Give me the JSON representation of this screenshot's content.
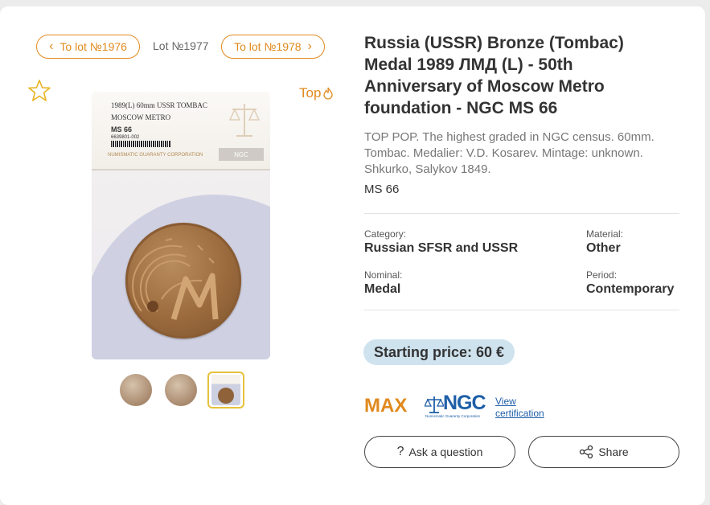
{
  "nav": {
    "prev_lot": "To lot №1976",
    "current_lot": "Lot №1977",
    "next_lot": "To lot №1978",
    "top_label": "Top"
  },
  "image": {
    "slab_line1": "1989(L) 60mm USSR TOMBAC",
    "slab_line2": "MOSCOW METRO",
    "slab_grade": "MS 66",
    "slab_cert": "6639801-002",
    "slab_maker": "NUMISMATIC GUARANTY CORPORATION",
    "slab_logo": "NGC"
  },
  "lot": {
    "title": "Russia (USSR) Bronze (Tombac) Medal 1989 ЛМД (L) - 50th Anniversary of Moscow Metro foundation - NGC MS 66",
    "description": "TOP POP. The highest graded in NGC census. 60mm. Tombac. Medalier: V.D. Kosarev. Mintage: unknown. Shkurko, Salykov 1849.",
    "grade": "MS 66"
  },
  "specs": {
    "category_label": "Category:",
    "category_value": "Russian SFSR and USSR",
    "material_label": "Material:",
    "material_value": "Other",
    "nominal_label": "Nominal:",
    "nominal_value": "Medal",
    "period_label": "Period:",
    "period_value": "Contemporary"
  },
  "price": {
    "starting": "Starting price: 60 €"
  },
  "cert": {
    "max": "MAX",
    "ngc": "NGC",
    "ngc_sub": "Numismatic Guaranty Corporation",
    "view_link": "View certification"
  },
  "actions": {
    "ask": "Ask a question",
    "share": "Share"
  },
  "colors": {
    "accent": "#e08a1e",
    "price_bg": "#cfe3ef",
    "ngc_blue": "#1f5fa8"
  }
}
